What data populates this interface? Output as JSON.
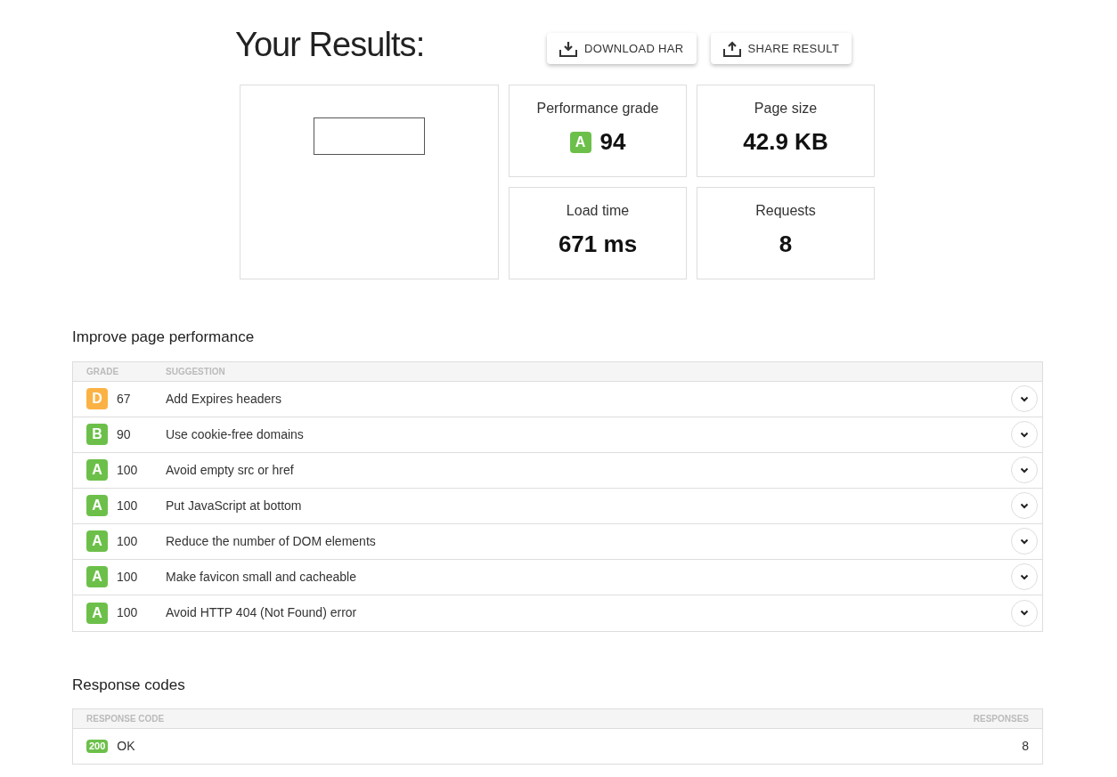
{
  "title": "Your Results:",
  "buttons": [
    {
      "kind": "download",
      "label": "DOWNLOAD HAR"
    },
    {
      "kind": "share",
      "label": "SHARE RESULT"
    }
  ],
  "metrics": [
    {
      "label": "Performance grade",
      "grade": "A",
      "color": "#6cc04a",
      "value": "94"
    },
    {
      "label": "Page size",
      "value": "42.9 KB"
    },
    {
      "label": "Load time",
      "value": "671 ms"
    },
    {
      "label": "Requests",
      "value": "8"
    }
  ],
  "performance": {
    "heading": "Improve page performance",
    "columns": [
      "GRADE",
      "SUGGESTION"
    ],
    "rows": [
      {
        "grade": "D",
        "color": "#fbb244",
        "score": "67",
        "suggestion": "Add Expires headers"
      },
      {
        "grade": "B",
        "color": "#6cc04a",
        "score": "90",
        "suggestion": "Use cookie-free domains"
      },
      {
        "grade": "A",
        "color": "#6cc04a",
        "score": "100",
        "suggestion": "Avoid empty src or href"
      },
      {
        "grade": "A",
        "color": "#6cc04a",
        "score": "100",
        "suggestion": "Put JavaScript at bottom"
      },
      {
        "grade": "A",
        "color": "#6cc04a",
        "score": "100",
        "suggestion": "Reduce the number of DOM elements"
      },
      {
        "grade": "A",
        "color": "#6cc04a",
        "score": "100",
        "suggestion": "Make favicon small and cacheable"
      },
      {
        "grade": "A",
        "color": "#6cc04a",
        "score": "100",
        "suggestion": "Avoid HTTP 404 (Not Found) error"
      }
    ]
  },
  "response_codes": {
    "heading": "Response codes",
    "columns": [
      "RESPONSE CODE",
      "RESPONSES"
    ],
    "rows": [
      {
        "code": "200",
        "color": "#6cc04a",
        "text": "OK",
        "responses": "8"
      }
    ]
  }
}
